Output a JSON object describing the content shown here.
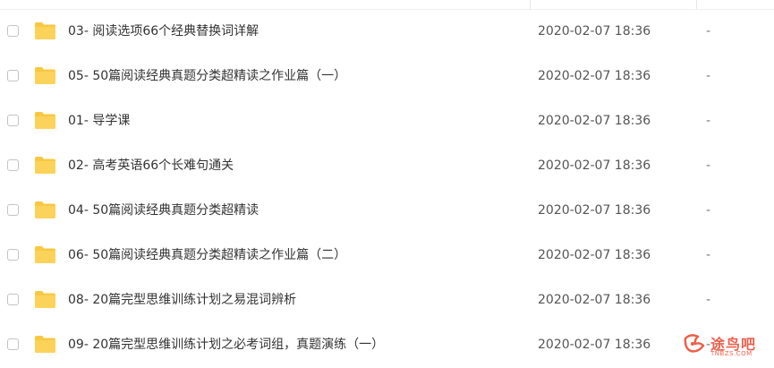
{
  "files": [
    {
      "name": "03- 阅读选项66个经典替换词详解",
      "date": "2020-02-07 18:36",
      "size": "-"
    },
    {
      "name": "05- 50篇阅读经典真题分类超精读之作业篇（一）",
      "date": "2020-02-07 18:36",
      "size": "-"
    },
    {
      "name": "01- 导学课",
      "date": "2020-02-07 18:36",
      "size": "-"
    },
    {
      "name": "02- 高考英语66个长难句通关",
      "date": "2020-02-07 18:36",
      "size": "-"
    },
    {
      "name": "04- 50篇阅读经典真题分类超精读",
      "date": "2020-02-07 18:36",
      "size": "-"
    },
    {
      "name": "06- 50篇阅读经典真题分类超精读之作业篇（二）",
      "date": "2020-02-07 18:36",
      "size": "-"
    },
    {
      "name": "08- 20篇完型思维训练计划之易混词辨析",
      "date": "2020-02-07 18:36",
      "size": "-"
    },
    {
      "name": "09- 20篇完型思维训练计划之必考词组，真题演练（一）",
      "date": "2020-02-07 18:36",
      "size": "-"
    }
  ],
  "icons": {
    "folder": "folder-icon",
    "checkbox": "checkbox"
  },
  "colors": {
    "folder": "#f9c841",
    "folder_tab": "#f2b52b",
    "text": "#333333",
    "watermark": "#e8452c"
  },
  "watermark": {
    "text": "途鸟吧",
    "sub": "TNBZS.COM"
  }
}
